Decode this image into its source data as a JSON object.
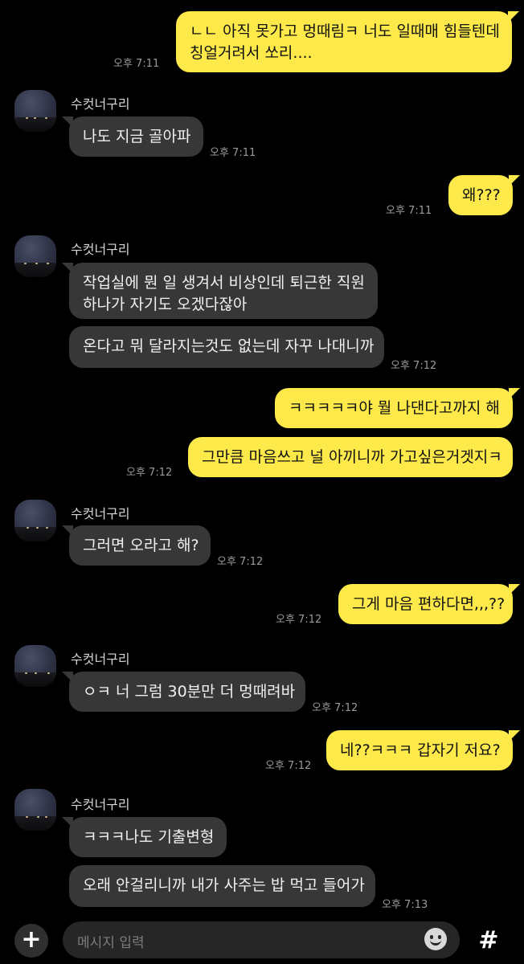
{
  "contact": {
    "name": "수컷너구리"
  },
  "messages": [
    {
      "text": "ㄴㄴ 아직 못가고 멍때림ㅋ 너도 일때매 힘들텐데",
      "text2": "칭얼거려서 쏘리....",
      "time": "오후 7:11"
    },
    {
      "text": "나도 지금 골아파",
      "time": "오후 7:11"
    },
    {
      "text": "왜???",
      "time": "오후 7:11"
    },
    {
      "text": "작업실에 뭔 일 생겨서 비상인데 퇴근한 직원",
      "text2": "하나가 자기도 오겠다잖아"
    },
    {
      "text": "온다고 뭐 달라지는것도 없는데 자꾸 나대니까",
      "time": "오후 7:12"
    },
    {
      "text": "ㅋㅋㅋㅋㅋ야 뭘 나댄다고까지 해"
    },
    {
      "text": "그만큼 마음쓰고 널 아끼니까 가고싶은거겟지ㅋ",
      "time": "오후 7:12"
    },
    {
      "text": "그러면 오라고 해?",
      "time": "오후 7:12"
    },
    {
      "text": "그게 마음 편하다면,,,??",
      "time": "오후 7:12"
    },
    {
      "text": "ㅇㅋ 너 그럼 30분만 더 멍때려바",
      "time": "오후 7:12"
    },
    {
      "text": "네??ㅋㅋㅋ 갑자기 저요?",
      "time": "오후 7:12"
    },
    {
      "text": "ㅋㅋㅋ나도 기출변형"
    },
    {
      "text": "오래 안걸리니까 내가 사주는 밥 먹고 들어가",
      "time": "오후 7:13"
    }
  ],
  "input": {
    "placeholder": "메시지 입력"
  },
  "buttons": {
    "plus": "+",
    "hash": "#"
  }
}
